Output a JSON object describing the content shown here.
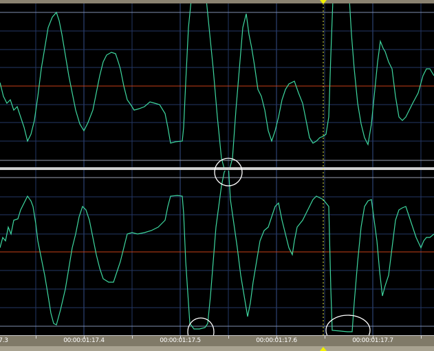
{
  "ruler": {
    "labels": [
      "7.3",
      "00:00:01:17.4",
      "00:00:01:17.5",
      "00:00:01:17.6",
      "00:00:01:17.7"
    ]
  },
  "colors": {
    "waveform": "#3ed8a0",
    "center_line": "#c84018",
    "grid": "#2a3a6a",
    "cursor": "#e8e840",
    "annotation": "#ffffff"
  },
  "channels": [
    "top-channel",
    "bottom-channel"
  ]
}
